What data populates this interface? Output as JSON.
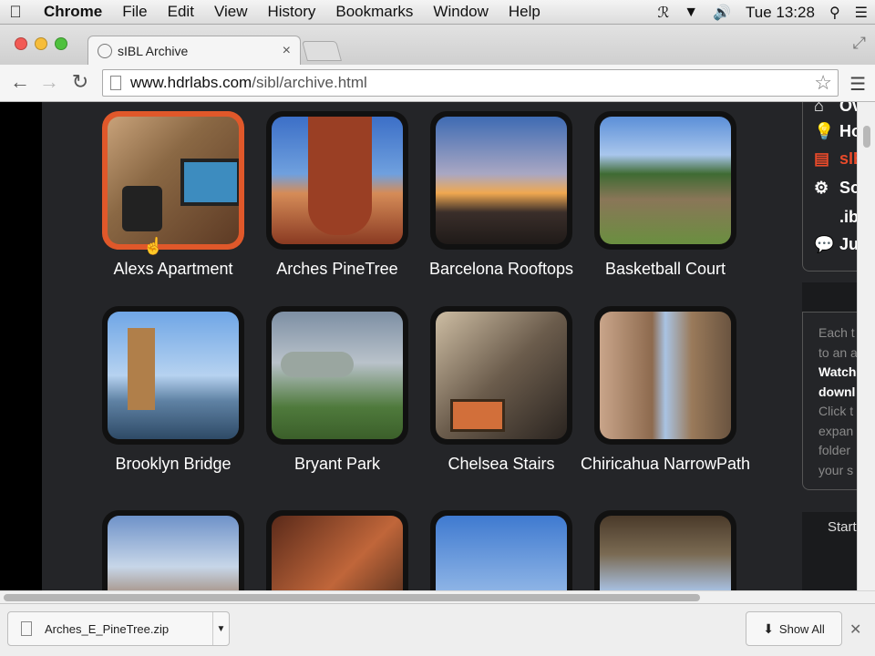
{
  "menubar": {
    "apple_icon": "apple-icon",
    "app_name": "Chrome",
    "items": [
      "File",
      "Edit",
      "View",
      "History",
      "Bookmarks",
      "Window",
      "Help"
    ],
    "clock": "Tue 13:28"
  },
  "tab": {
    "title": "sIBL Archive",
    "close": "×"
  },
  "toolbar": {
    "url_host": "www.hdrlabs.com",
    "url_path": "/sibl/archive.html"
  },
  "gallery": {
    "items": [
      {
        "label": "Alexs Apartment",
        "selected": true
      },
      {
        "label": "Arches PineTree"
      },
      {
        "label": "Barcelona Rooftops"
      },
      {
        "label": "Basketball Court"
      },
      {
        "label": "Brooklyn Bridge"
      },
      {
        "label": "Bryant Park"
      },
      {
        "label": "Chelsea Stairs"
      },
      {
        "label": "Chiricahua NarrowPath"
      },
      {
        "label": ""
      },
      {
        "label": ""
      },
      {
        "label": ""
      },
      {
        "label": ""
      }
    ]
  },
  "sidebar": {
    "nav": [
      {
        "label": "Ov",
        "icon": "home-icon"
      },
      {
        "label": "Ho",
        "icon": "lightbulb-icon"
      },
      {
        "label": "sIB",
        "icon": "sibl-icon",
        "active": true
      },
      {
        "label": "So",
        "icon": "gear-icon"
      },
      {
        "label": ".ib",
        "icon": ""
      },
      {
        "label": "Jun",
        "icon": "chat-bubble-icon"
      }
    ],
    "info_lines": [
      "Each t",
      "to an a",
      "Watch",
      "downl",
      "Click t",
      "expan",
      "folder",
      "your s"
    ],
    "bottom_label": "Start"
  },
  "download": {
    "filename": "Arches_E_PineTree.zip",
    "show_all": "Show All"
  },
  "colors": {
    "selected_border": "#e0582a",
    "active_nav": "#e84a2a",
    "page_bg": "#242528"
  }
}
